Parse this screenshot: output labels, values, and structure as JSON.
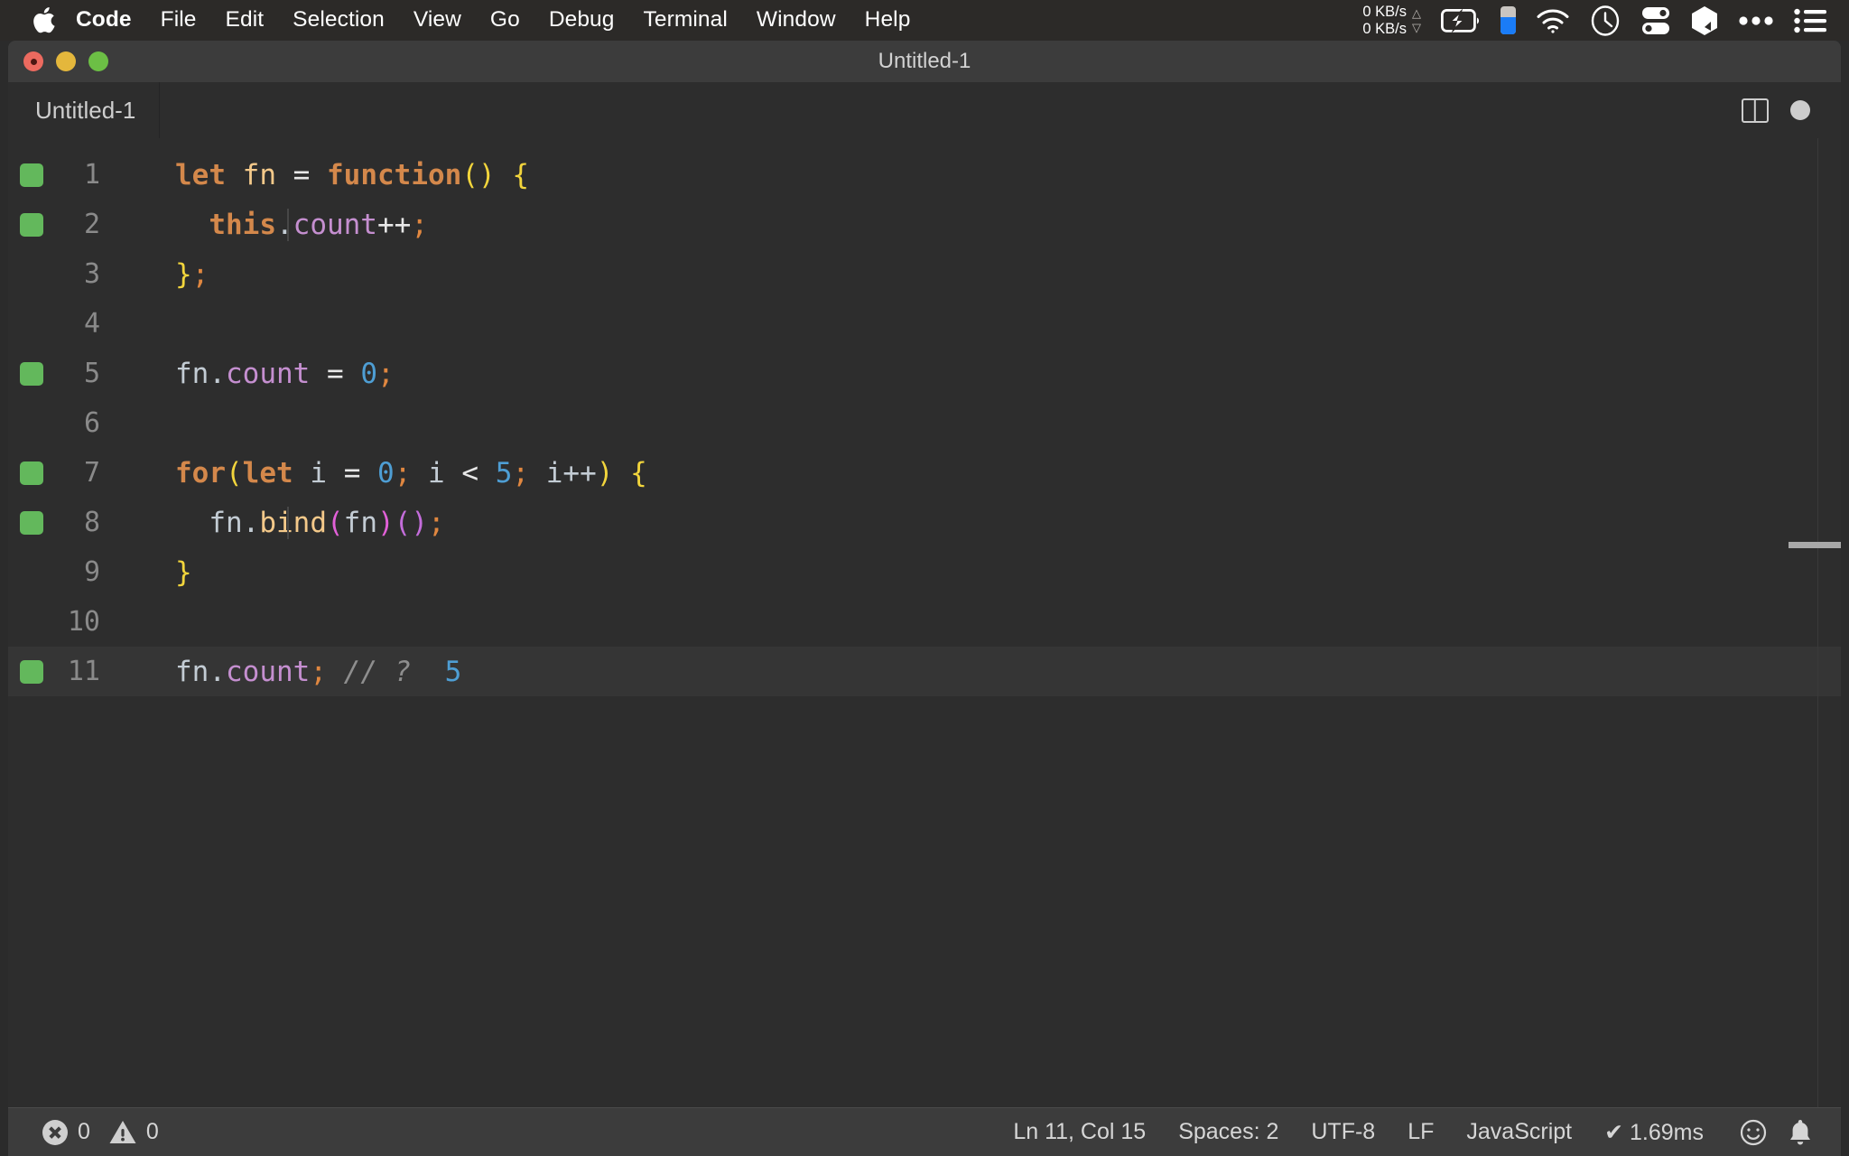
{
  "menubar": {
    "apple_icon": "apple-logo-icon",
    "items": [
      {
        "label": "Code",
        "bold": true
      },
      {
        "label": "File",
        "bold": false
      },
      {
        "label": "Edit",
        "bold": false
      },
      {
        "label": "Selection",
        "bold": false
      },
      {
        "label": "View",
        "bold": false
      },
      {
        "label": "Go",
        "bold": false
      },
      {
        "label": "Debug",
        "bold": false
      },
      {
        "label": "Terminal",
        "bold": false
      },
      {
        "label": "Window",
        "bold": false
      },
      {
        "label": "Help",
        "bold": false
      }
    ],
    "status_items": {
      "net_up": "0 KB/s",
      "net_down": "0 KB/s",
      "up_arrow": "△",
      "down_arrow": "▽",
      "icons": [
        "battery-charging-icon",
        "battery-level-blue-icon",
        "wifi-icon",
        "clock-icon",
        "control-center-icon",
        "bartender-icon",
        "ellipsis-icon",
        "menu-list-icon"
      ]
    }
  },
  "window": {
    "title": "Untitled-1",
    "traffic_lights": [
      "close",
      "minimize",
      "zoom"
    ]
  },
  "tabbar": {
    "tabs": [
      {
        "label": "Untitled-1",
        "active": true,
        "dirty": true
      }
    ],
    "actions": [
      "split-editor-icon",
      "unsaved-dot-icon"
    ]
  },
  "editor": {
    "language": "JavaScript",
    "current_line": 11,
    "lines": [
      {
        "num": "1",
        "covered": true,
        "indent_guide": false,
        "current": false,
        "tokens": [
          {
            "t": "let",
            "c": "t-kw"
          },
          {
            "t": " ",
            "c": "t-op"
          },
          {
            "t": "fn",
            "c": "t-fnname"
          },
          {
            "t": " ",
            "c": "t-op"
          },
          {
            "t": "=",
            "c": "t-op"
          },
          {
            "t": " ",
            "c": "t-op"
          },
          {
            "t": "function",
            "c": "t-kw"
          },
          {
            "t": "()",
            "c": "t-yellow"
          },
          {
            "t": " ",
            "c": "t-op"
          },
          {
            "t": "{",
            "c": "t-yellow"
          }
        ]
      },
      {
        "num": "2",
        "covered": true,
        "indent_guide": true,
        "current": false,
        "tokens": [
          {
            "t": "  ",
            "c": "t-op"
          },
          {
            "t": "this",
            "c": "t-kw"
          },
          {
            "t": ".",
            "c": "t-var"
          },
          {
            "t": "count",
            "c": "t-prop"
          },
          {
            "t": "++",
            "c": "t-op"
          },
          {
            "t": ";",
            "c": "t-semi"
          }
        ]
      },
      {
        "num": "3",
        "covered": false,
        "indent_guide": false,
        "current": false,
        "tokens": [
          {
            "t": "}",
            "c": "t-yellow"
          },
          {
            "t": ";",
            "c": "t-semi"
          }
        ]
      },
      {
        "num": "4",
        "covered": false,
        "indent_guide": false,
        "current": false,
        "tokens": []
      },
      {
        "num": "5",
        "covered": true,
        "indent_guide": false,
        "current": false,
        "tokens": [
          {
            "t": "fn",
            "c": "t-var"
          },
          {
            "t": ".",
            "c": "t-var"
          },
          {
            "t": "count",
            "c": "t-prop"
          },
          {
            "t": " ",
            "c": "t-op"
          },
          {
            "t": "=",
            "c": "t-op"
          },
          {
            "t": " ",
            "c": "t-op"
          },
          {
            "t": "0",
            "c": "t-num"
          },
          {
            "t": ";",
            "c": "t-semi"
          }
        ]
      },
      {
        "num": "6",
        "covered": false,
        "indent_guide": false,
        "current": false,
        "tokens": []
      },
      {
        "num": "7",
        "covered": true,
        "indent_guide": false,
        "current": false,
        "tokens": [
          {
            "t": "for",
            "c": "t-kw"
          },
          {
            "t": "(",
            "c": "t-yellow"
          },
          {
            "t": "let",
            "c": "t-kw"
          },
          {
            "t": " ",
            "c": "t-op"
          },
          {
            "t": "i",
            "c": "t-var"
          },
          {
            "t": " ",
            "c": "t-op"
          },
          {
            "t": "=",
            "c": "t-op"
          },
          {
            "t": " ",
            "c": "t-op"
          },
          {
            "t": "0",
            "c": "t-num"
          },
          {
            "t": ";",
            "c": "t-semi"
          },
          {
            "t": " ",
            "c": "t-op"
          },
          {
            "t": "i",
            "c": "t-var"
          },
          {
            "t": " ",
            "c": "t-op"
          },
          {
            "t": "<",
            "c": "t-op"
          },
          {
            "t": " ",
            "c": "t-op"
          },
          {
            "t": "5",
            "c": "t-num"
          },
          {
            "t": ";",
            "c": "t-semi"
          },
          {
            "t": " ",
            "c": "t-op"
          },
          {
            "t": "i++",
            "c": "t-var"
          },
          {
            "t": ")",
            "c": "t-yellow"
          },
          {
            "t": " ",
            "c": "t-op"
          },
          {
            "t": "{",
            "c": "t-yellow"
          }
        ]
      },
      {
        "num": "8",
        "covered": true,
        "indent_guide": true,
        "current": false,
        "tokens": [
          {
            "t": "  ",
            "c": "t-op"
          },
          {
            "t": "fn",
            "c": "t-var"
          },
          {
            "t": ".",
            "c": "t-var"
          },
          {
            "t": "bind",
            "c": "t-fnname"
          },
          {
            "t": "(",
            "c": "t-pink"
          },
          {
            "t": "fn",
            "c": "t-var"
          },
          {
            "t": ")",
            "c": "t-pink"
          },
          {
            "t": "(",
            "c": "t-purple"
          },
          {
            "t": ")",
            "c": "t-purple"
          },
          {
            "t": ";",
            "c": "t-semi"
          }
        ]
      },
      {
        "num": "9",
        "covered": false,
        "indent_guide": false,
        "current": false,
        "tokens": [
          {
            "t": "}",
            "c": "t-yellow"
          }
        ]
      },
      {
        "num": "10",
        "covered": false,
        "indent_guide": false,
        "current": false,
        "tokens": []
      },
      {
        "num": "11",
        "covered": true,
        "indent_guide": false,
        "current": true,
        "tokens": [
          {
            "t": "fn",
            "c": "t-var"
          },
          {
            "t": ".",
            "c": "t-var"
          },
          {
            "t": "count",
            "c": "t-prop"
          },
          {
            "t": ";",
            "c": "t-semi"
          },
          {
            "t": " ",
            "c": "t-op"
          },
          {
            "t": "// ?",
            "c": "t-comment"
          },
          {
            "t": "  ",
            "c": "t-op"
          },
          {
            "t": "5",
            "c": "t-num"
          }
        ]
      }
    ]
  },
  "statusbar": {
    "errors": "0",
    "warnings": "0",
    "error_icon": "error-circle-icon",
    "warning_icon": "warning-triangle-icon",
    "right_items": [
      "Ln 11, Col 15",
      "Spaces: 2",
      "UTF-8",
      "LF",
      "JavaScript",
      "✔ 1.69ms"
    ],
    "feedback_icon": "smiley-icon",
    "bell_icon": "bell-icon"
  },
  "colors": {
    "menubar_bg": "#2c2a28",
    "titlebar_bg": "#3c3c3c",
    "editor_bg": "#2d2d2d",
    "current_line_bg": "#353535",
    "statusbar_bg": "#3c3c3c",
    "coverage_green": "#63b85c",
    "accent_blue": "#1a7cf7"
  }
}
